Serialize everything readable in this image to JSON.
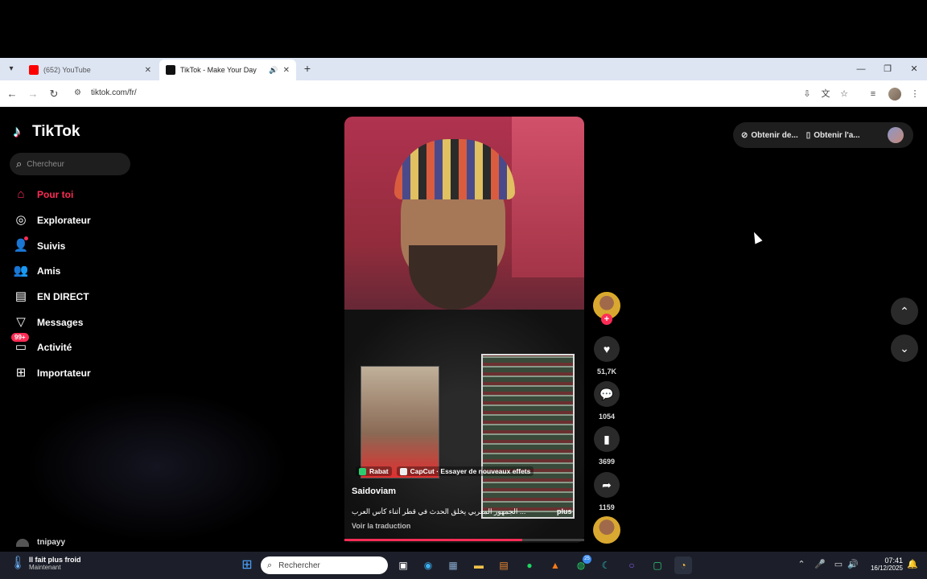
{
  "browser": {
    "tabs": [
      {
        "label": "(652) YouTube",
        "favicon_color": "#ff0000",
        "active": false
      },
      {
        "label": "TikTok - Make Your Day",
        "favicon_color": "#111111",
        "active": true
      }
    ],
    "url": "tiktok.com/fr/"
  },
  "tiktok": {
    "logo": "TikTok",
    "search_placeholder": "Chercheur",
    "nav": [
      {
        "label": "Pour toi",
        "icon": "home-icon"
      },
      {
        "label": "Explorateur",
        "icon": "compass-icon"
      },
      {
        "label": "Suivis",
        "icon": "following-icon"
      },
      {
        "label": "Amis",
        "icon": "friends-icon"
      },
      {
        "label": "EN DIRECT",
        "icon": "live-icon"
      },
      {
        "label": "Messages",
        "icon": "messages-icon"
      },
      {
        "label": "Activité",
        "icon": "activity-icon"
      },
      {
        "label": "Importateur",
        "icon": "upload-icon"
      }
    ],
    "activity_badge": "99+",
    "bottom_user": "tnipayy",
    "top_pill": {
      "item1": "Obtenir de...",
      "item2": "Obtenir l'a..."
    },
    "video": {
      "tag_location": "Rabat",
      "tag_effect": "CapCut · Essayer de nouveaux effets",
      "author": "Saidoviam",
      "description": "الجمهور المغربي يخلق الحدث في قطر أثناء كأس العرب ...",
      "more": "plus",
      "translate": "Voir la traduction",
      "progress": 0.74,
      "likes": "51,7K",
      "comments": "1054",
      "saves": "3699",
      "shares": "1159"
    }
  },
  "taskbar": {
    "weather_title": "Il fait plus froid",
    "weather_sub": "Maintenant",
    "search_placeholder": "Rechercher",
    "whatsapp_badge": "25",
    "time": "07:41",
    "date": "16/12/2025"
  },
  "colors": {
    "accent": "#fe2c55",
    "sidebar_bg": "#000000",
    "pill_bg": "#1e1e1e"
  }
}
